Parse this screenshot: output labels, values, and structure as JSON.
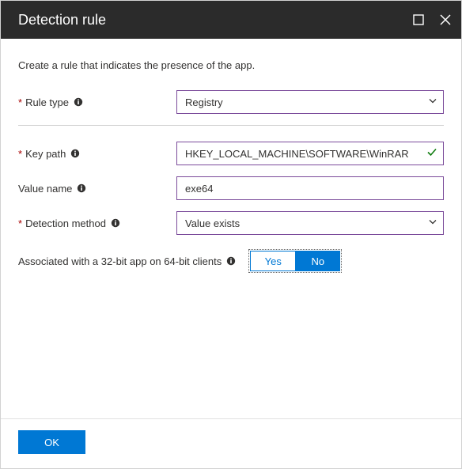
{
  "title": "Detection rule",
  "intro": "Create a rule that indicates the presence of the app.",
  "labels": {
    "rule_type": "Rule type",
    "key_path": "Key path",
    "value_name": "Value name",
    "detection_method": "Detection method",
    "associated": "Associated with a 32-bit app on 64-bit clients"
  },
  "values": {
    "rule_type": "Registry",
    "key_path": "HKEY_LOCAL_MACHINE\\SOFTWARE\\WinRAR",
    "value_name": "exe64",
    "detection_method": "Value exists"
  },
  "toggle": {
    "yes": "Yes",
    "no": "No",
    "selected": "No"
  },
  "buttons": {
    "ok": "OK"
  }
}
